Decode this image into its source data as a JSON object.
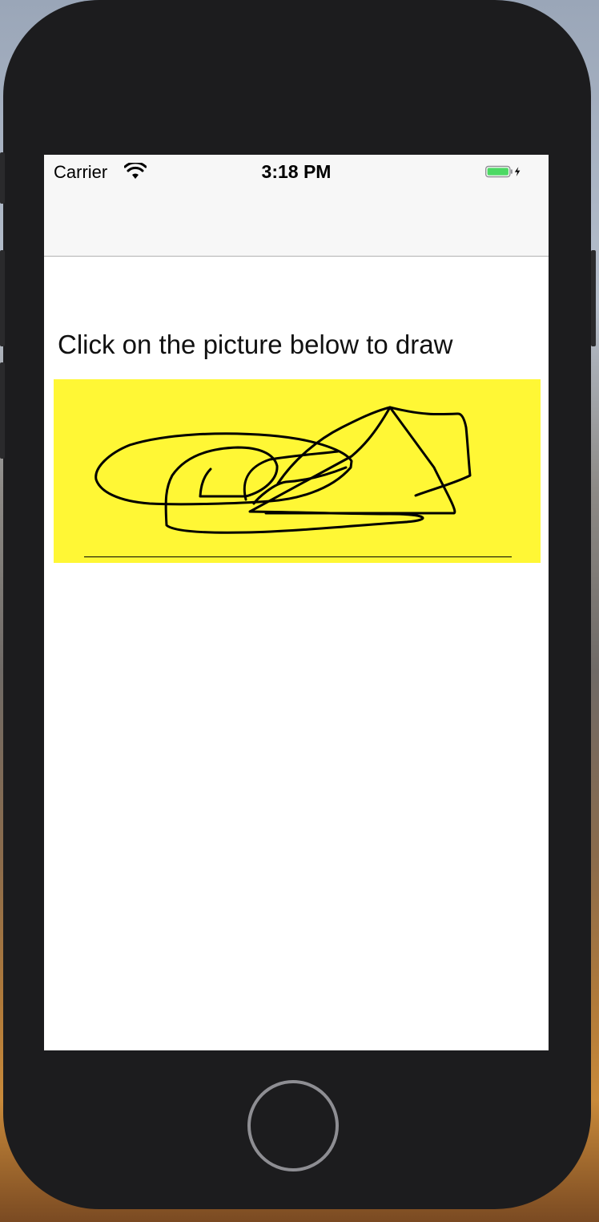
{
  "status_bar": {
    "carrier": "Carrier",
    "time": "3:18 PM",
    "wifi_icon": "wifi-icon",
    "battery_icon": "battery-charging-icon",
    "battery_color": "#4cd964"
  },
  "main": {
    "instruction": "Click on the picture below to draw",
    "canvas_background": "#fff735"
  },
  "device": {
    "home_button_icon": "home-button"
  }
}
